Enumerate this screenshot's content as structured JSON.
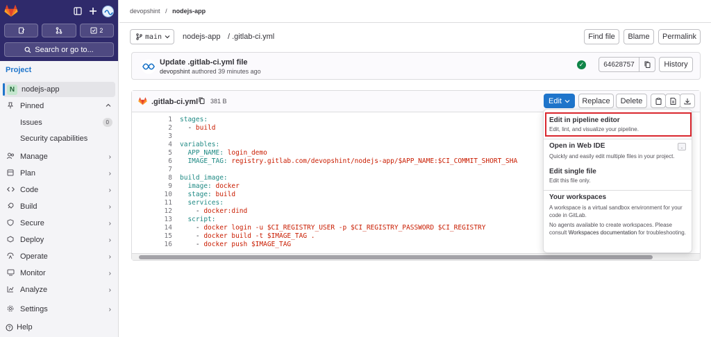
{
  "sidebar": {
    "merge_count": "2",
    "search_label": "Search or go to...",
    "section_label": "Project",
    "project": {
      "initial": "N",
      "name": "nodejs-app"
    },
    "pinned_label": "Pinned",
    "pinned_items": [
      {
        "label": "Issues",
        "count": "0"
      },
      {
        "label": "Security capabilities"
      }
    ],
    "nav": [
      {
        "label": "Manage",
        "icon": "manage-icon"
      },
      {
        "label": "Plan",
        "icon": "plan-icon"
      },
      {
        "label": "Code",
        "icon": "code-icon"
      },
      {
        "label": "Build",
        "icon": "rocket-icon"
      },
      {
        "label": "Secure",
        "icon": "shield-icon"
      },
      {
        "label": "Deploy",
        "icon": "deploy-icon"
      },
      {
        "label": "Operate",
        "icon": "operate-icon"
      },
      {
        "label": "Monitor",
        "icon": "monitor-icon"
      },
      {
        "label": "Analyze",
        "icon": "analyze-icon"
      }
    ],
    "settings_label": "Settings",
    "help_label": "Help"
  },
  "breadcrumb": {
    "group": "devopshint",
    "separator": "/",
    "project": "nodejs-app"
  },
  "toolbar": {
    "branch": "main",
    "path_project": "nodejs-app",
    "path_file": "/ .gitlab-ci.yml",
    "find_file": "Find file",
    "blame": "Blame",
    "permalink": "Permalink"
  },
  "commit": {
    "title": "Update .gitlab-ci.yml file",
    "author": "devopshint",
    "meta_rest": "authored 39 minutes ago",
    "sha": "64628757",
    "history": "History"
  },
  "file": {
    "name": ".gitlab-ci.yml",
    "size": "381 B",
    "edit": "Edit",
    "replace": "Replace",
    "delete": "Delete"
  },
  "code_lines": [
    {
      "n": "1",
      "parts": [
        [
          "k",
          "stages:"
        ]
      ]
    },
    {
      "n": "2",
      "parts": [
        [
          "d",
          "  - "
        ],
        [
          "s",
          "build"
        ]
      ]
    },
    {
      "n": "3",
      "parts": []
    },
    {
      "n": "4",
      "parts": [
        [
          "k",
          "variables:"
        ]
      ]
    },
    {
      "n": "5",
      "parts": [
        [
          "k",
          "  APP_NAME: "
        ],
        [
          "s",
          "login_demo"
        ]
      ]
    },
    {
      "n": "6",
      "parts": [
        [
          "k",
          "  IMAGE_TAG: "
        ],
        [
          "s",
          "registry.gitlab.com/devopshint/nodejs-app/$APP_NAME:$CI_COMMIT_SHORT_SHA"
        ]
      ]
    },
    {
      "n": "7",
      "parts": []
    },
    {
      "n": "8",
      "parts": [
        [
          "k",
          "build_image:"
        ]
      ]
    },
    {
      "n": "9",
      "parts": [
        [
          "k",
          "  image: "
        ],
        [
          "s",
          "docker"
        ]
      ]
    },
    {
      "n": "10",
      "parts": [
        [
          "k",
          "  stage: "
        ],
        [
          "s",
          "build"
        ]
      ]
    },
    {
      "n": "11",
      "parts": [
        [
          "k",
          "  services:"
        ]
      ]
    },
    {
      "n": "12",
      "parts": [
        [
          "d",
          "    - "
        ],
        [
          "s",
          "docker:dind"
        ]
      ]
    },
    {
      "n": "13",
      "parts": [
        [
          "k",
          "  script:"
        ]
      ]
    },
    {
      "n": "14",
      "parts": [
        [
          "d",
          "    - "
        ],
        [
          "s",
          "docker login -u $CI_REGISTRY_USER -p $CI_REGISTRY_PASSWORD $CI_REGISTRY"
        ]
      ]
    },
    {
      "n": "15",
      "parts": [
        [
          "d",
          "    - "
        ],
        [
          "s",
          "docker build -t $IMAGE_TAG ."
        ]
      ]
    },
    {
      "n": "16",
      "parts": [
        [
          "d",
          "    - "
        ],
        [
          "s",
          "docker push $IMAGE_TAG"
        ]
      ]
    }
  ],
  "edit_menu": {
    "pipeline_title": "Edit in pipeline editor",
    "pipeline_desc": "Edit, lint, and visualize your pipeline.",
    "webide_title": "Open in Web IDE",
    "webide_shortcut": ".",
    "webide_desc": "Quickly and easily edit multiple files in your project.",
    "single_title": "Edit single file",
    "single_desc": "Edit this file only.",
    "workspaces_title": "Your workspaces",
    "workspaces_desc1": "A workspace is a virtual sandbox environment for your code in GitLab.",
    "workspaces_desc2_a": "No agents available to create workspaces. Please consult ",
    "workspaces_desc2_link": "Workspaces documentation",
    "workspaces_desc2_b": " for troubleshooting."
  },
  "colors": {
    "sidebar_top": "#2f2a6b",
    "accent": "#1f75cb",
    "highlight": "#d9262d",
    "success": "#108548"
  }
}
